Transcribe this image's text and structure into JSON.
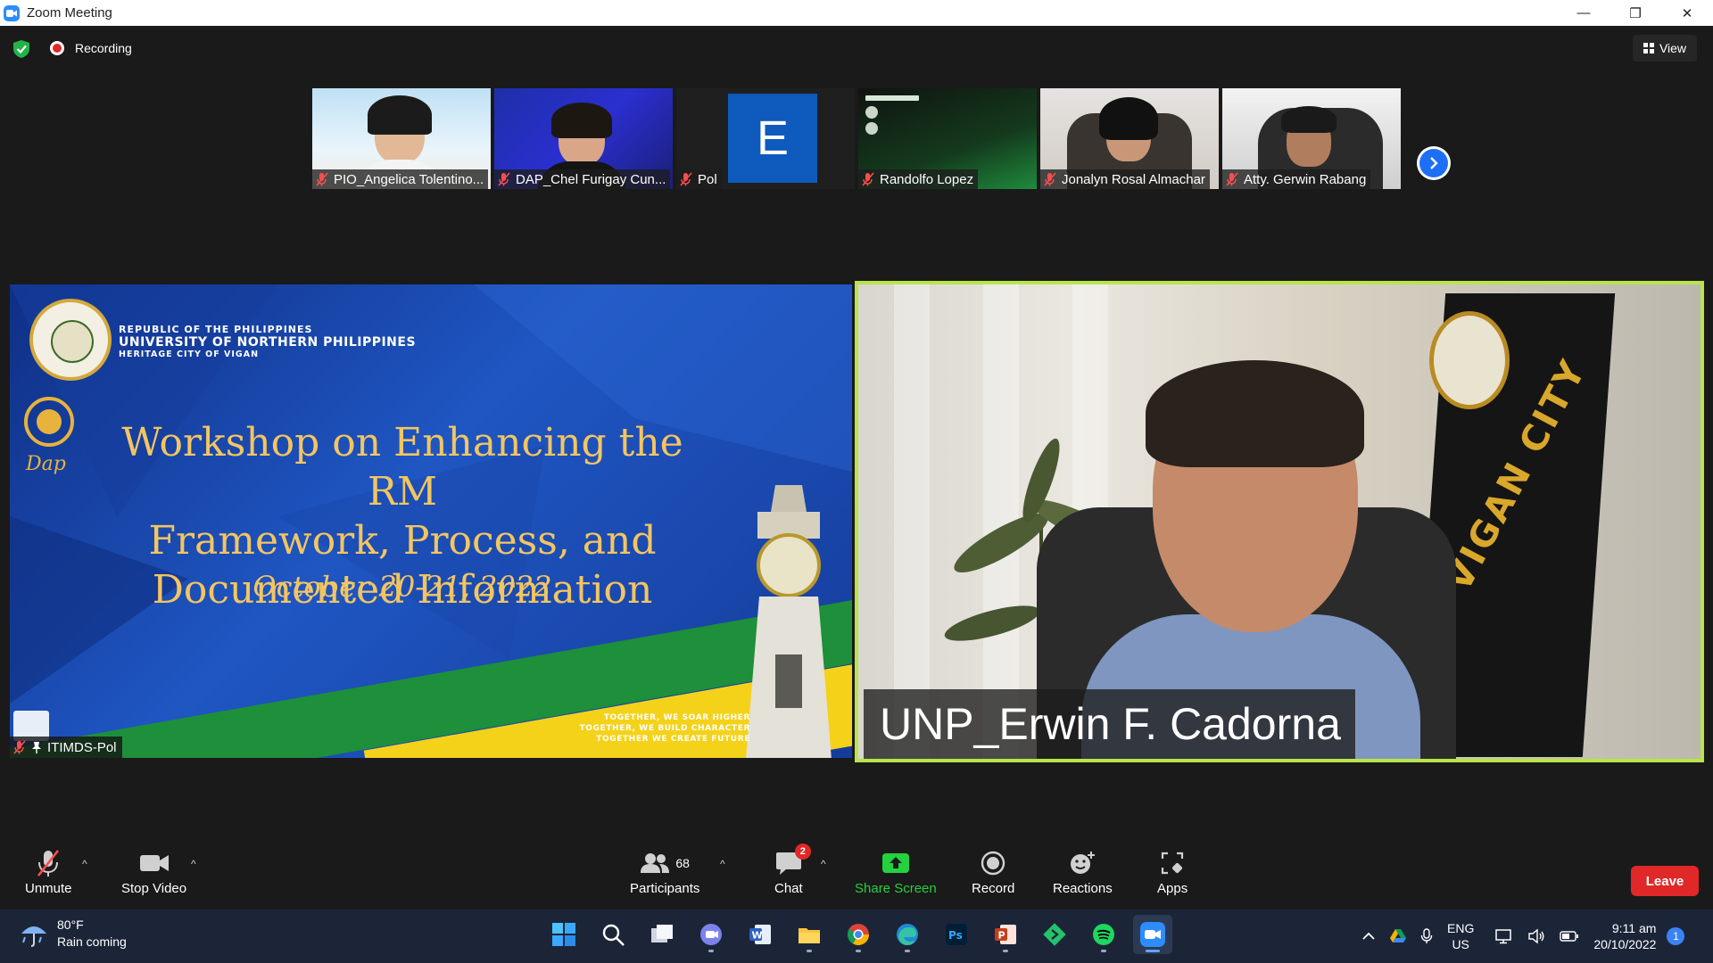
{
  "window": {
    "title": "Zoom Meeting",
    "controls": {
      "minimize": "—",
      "restore": "❐",
      "close": "✕"
    }
  },
  "topbar": {
    "recording_label": "Recording",
    "view_label": "View"
  },
  "thumbnails": [
    {
      "name": "PIO_Angelica Tolentino..."
    },
    {
      "name": "DAP_Chel Furigay Cun..."
    },
    {
      "name": "Pol",
      "avatar_letter": "E"
    },
    {
      "name": "Randolfo Lopez"
    },
    {
      "name": "Jonalyn Rosal Almachar"
    },
    {
      "name": "Atty. Gerwin Rabang"
    }
  ],
  "slide": {
    "header_line1": "REPUBLIC OF THE PHILIPPINES",
    "header_line2": "UNIVERSITY OF NORTHERN PHILIPPINES",
    "header_line3": "HERITAGE CITY OF VIGAN",
    "title_line1": "Workshop on Enhancing the RM",
    "title_line2": "Framework, Process, and",
    "title_line3": "Documented Information",
    "date": "October 20-21, 2022",
    "motto_line1": "TOGETHER, WE SOAR HIGHER",
    "motto_line2": "TOGETHER, WE BUILD CHARACTER",
    "motto_line3": "TOGETHER WE CREATE FUTURE",
    "dap_label": "Dap",
    "sharer_name": "ITIMDS-Pol"
  },
  "speaker": {
    "name": "UNP_Erwin F. Cadorna",
    "flag_text": "VIGAN CITY"
  },
  "controls": {
    "unmute": "Unmute",
    "stop_video": "Stop Video",
    "participants": "Participants",
    "participants_count": "68",
    "chat": "Chat",
    "chat_badge": "2",
    "share_screen": "Share Screen",
    "record": "Record",
    "reactions": "Reactions",
    "apps": "Apps",
    "leave": "Leave"
  },
  "taskbar": {
    "weather_temp": "80°F",
    "weather_desc": "Rain coming",
    "lang_line1": "ENG",
    "lang_line2": "US",
    "time": "9:11 am",
    "date": "20/10/2022",
    "notification_count": "1",
    "apps": [
      "start",
      "search",
      "task-view",
      "teams-chat",
      "word",
      "file-explorer",
      "chrome",
      "edge",
      "photoshop",
      "powerpoint",
      "git",
      "spotify",
      "zoom"
    ]
  },
  "colors": {
    "zoom_blue": "#2d8cff",
    "leave_red": "#e02828",
    "share_green": "#24d13f",
    "active_speaker_border": "#b9e44a",
    "slide_gold": "#f3c561"
  }
}
